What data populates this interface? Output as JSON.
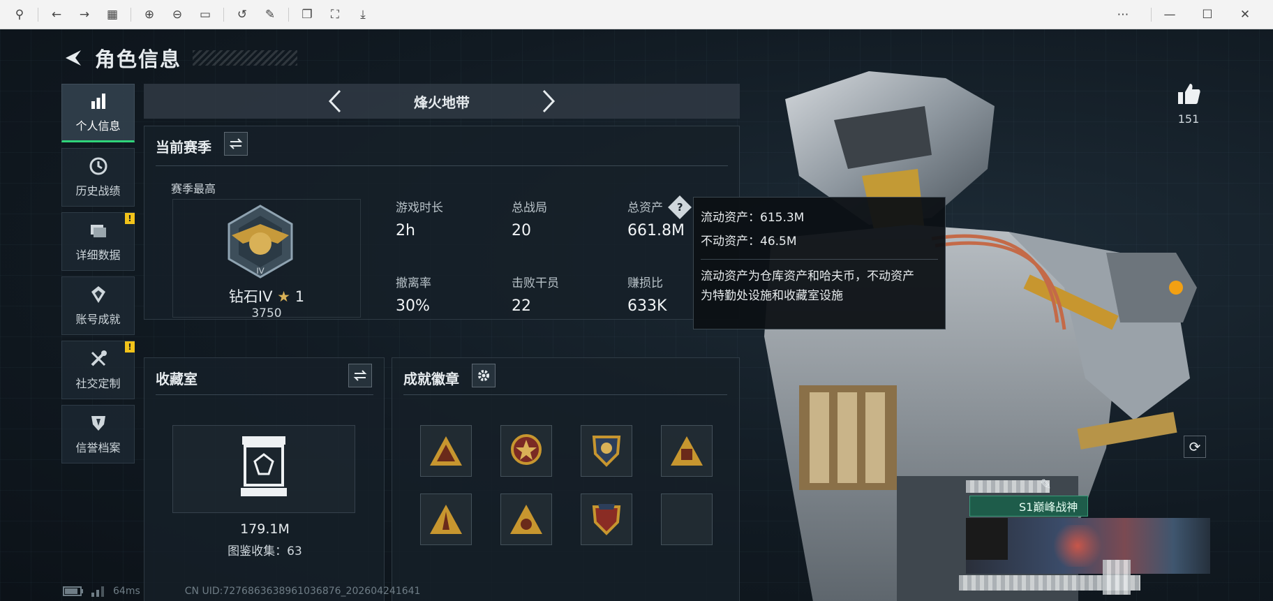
{
  "page": {
    "title": "角色信息"
  },
  "nav": [
    {
      "label": "个人信息",
      "active": true,
      "icon": "bar-chart-icon",
      "badge": ""
    },
    {
      "label": "历史战绩",
      "active": false,
      "icon": "clock-icon",
      "badge": ""
    },
    {
      "label": "详细数据",
      "active": false,
      "icon": "folder-icon",
      "badge": "!"
    },
    {
      "label": "账号成就",
      "active": false,
      "icon": "medal-icon",
      "badge": ""
    },
    {
      "label": "社交定制",
      "active": false,
      "icon": "tools-icon",
      "badge": "!"
    },
    {
      "label": "信誉档案",
      "active": false,
      "icon": "shield-icon",
      "badge": ""
    }
  ],
  "mode": {
    "label": "烽火地带"
  },
  "season": {
    "title": "当前赛季",
    "best_label": "赛季最高",
    "rank_name": "钻石IV",
    "rank_stars": "1",
    "rank_score": "3750",
    "stats": [
      {
        "label": "游戏时长",
        "value": "2h"
      },
      {
        "label": "总战局",
        "value": "20"
      },
      {
        "label": "总资产",
        "value": "661.8M"
      },
      {
        "label": "撤离率",
        "value": "30%"
      },
      {
        "label": "击败干员",
        "value": "22"
      },
      {
        "label": "赚损比",
        "value": "633K"
      }
    ]
  },
  "tooltip": {
    "liquid": "流动资产：615.3M",
    "fixed": "不动资产：46.5M",
    "desc_1": "流动资产为仓库资产和哈夫币，不动资产",
    "desc_2": "为特勤处设施和收藏室设施"
  },
  "collection": {
    "title": "收藏室",
    "value": "179.1M",
    "count": "图鉴收集：63"
  },
  "achievements": {
    "title": "成就徽章"
  },
  "likes": {
    "count": "151"
  },
  "player": {
    "title_tag": "S1巅峰战神"
  },
  "status": {
    "latency": "64ms",
    "uid": "CN UID:7276863638961036876_202604241641"
  },
  "colors": {
    "accent": "#2fd47a",
    "warning": "#f2c31a",
    "badge_gold": "#c7962f"
  }
}
